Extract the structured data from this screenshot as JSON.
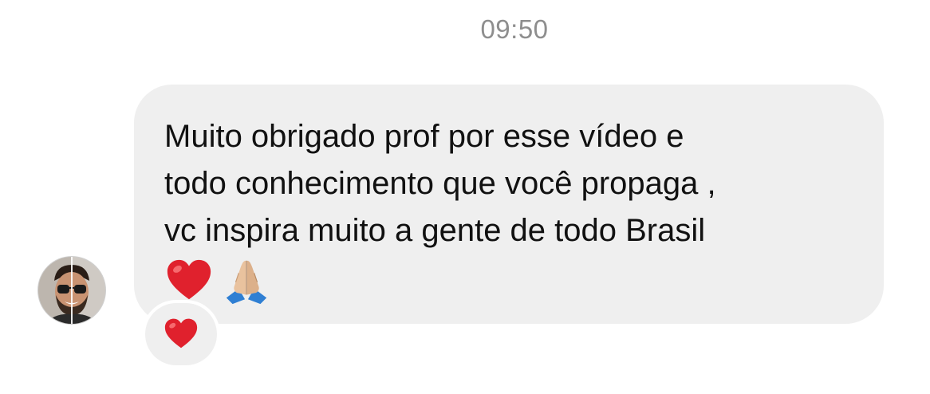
{
  "conversation": {
    "timestamp": "09:50"
  },
  "message": {
    "text": "Muito obrigado prof por esse vídeo e\ntodo conhecimento que você propaga ,\nvc inspira  muito  a gente de todo Brasil",
    "emojis": [
      "red-heart",
      "folded-hands"
    ]
  },
  "reaction": {
    "emoji": "red-heart"
  },
  "colors": {
    "bubble_bg": "#efefef",
    "timestamp": "#8e8e8e",
    "text": "#111111",
    "heart": "#e0212d"
  }
}
